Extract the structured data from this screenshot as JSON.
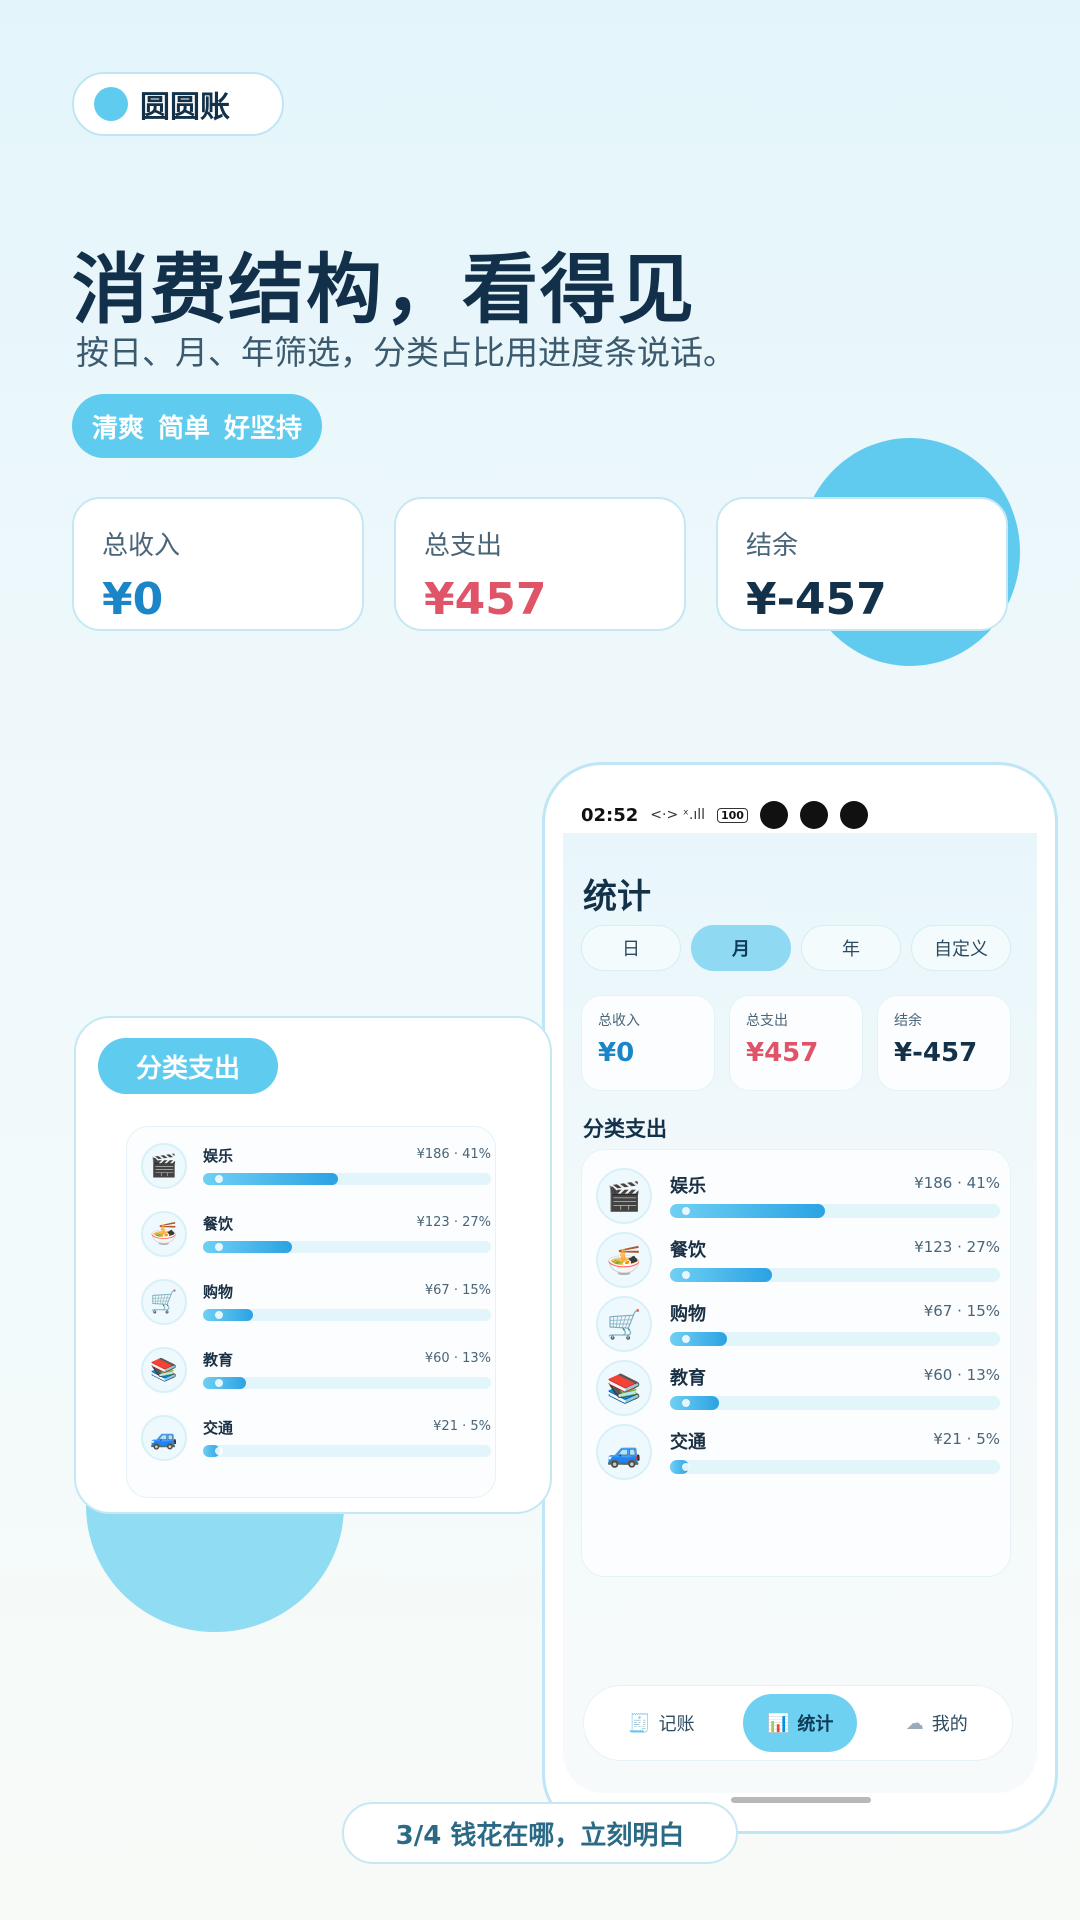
{
  "brand": {
    "name": "圆圆账"
  },
  "headline": "消费结构，看得见",
  "subline": "按日、月、年筛选，分类占比用进度条说话。",
  "tags": [
    "清爽",
    "简单",
    "好坚持"
  ],
  "summary": [
    {
      "label": "总收入",
      "value": "¥0",
      "color": "#1a86c8"
    },
    {
      "label": "总支出",
      "value": "¥457",
      "color": "#e05468"
    },
    {
      "label": "结余",
      "value": "¥-457",
      "color": "#13324a"
    }
  ],
  "phone": {
    "status": {
      "time": "02:52",
      "signal": "<·> ˣ.ıll",
      "battery": "100"
    },
    "title": "统计",
    "tabs": [
      {
        "label": "日",
        "active": false
      },
      {
        "label": "月",
        "active": true
      },
      {
        "label": "年",
        "active": false
      },
      {
        "label": "自定义",
        "active": false
      }
    ],
    "category_header": "分类支出",
    "nav": [
      {
        "label": "记账",
        "icon": "receipt-icon",
        "glyph": "🧾",
        "active": false
      },
      {
        "label": "统计",
        "icon": "bar-chart-icon",
        "glyph": "📊",
        "active": true
      },
      {
        "label": "我的",
        "icon": "cloud-icon",
        "glyph": "☁",
        "active": false
      }
    ]
  },
  "categories": [
    {
      "name": "娱乐",
      "amount": "¥186 · 41%",
      "percent": 41,
      "icon": "clapperboard-icon",
      "glyph": "🎬"
    },
    {
      "name": "餐饮",
      "amount": "¥123 · 27%",
      "percent": 27,
      "icon": "noodle-bowl-icon",
      "glyph": "🍜"
    },
    {
      "name": "购物",
      "amount": "¥67 · 15%",
      "percent": 15,
      "icon": "shopping-cart-icon",
      "glyph": "🛒"
    },
    {
      "name": "教育",
      "amount": "¥60 · 13%",
      "percent": 13,
      "icon": "books-icon",
      "glyph": "📚"
    },
    {
      "name": "交通",
      "amount": "¥21 · 5%",
      "percent": 5,
      "icon": "car-icon",
      "glyph": "🚙"
    }
  ],
  "floating_card": {
    "title": "分类支出"
  },
  "footer": "3/4  钱花在哪，立刻明白"
}
